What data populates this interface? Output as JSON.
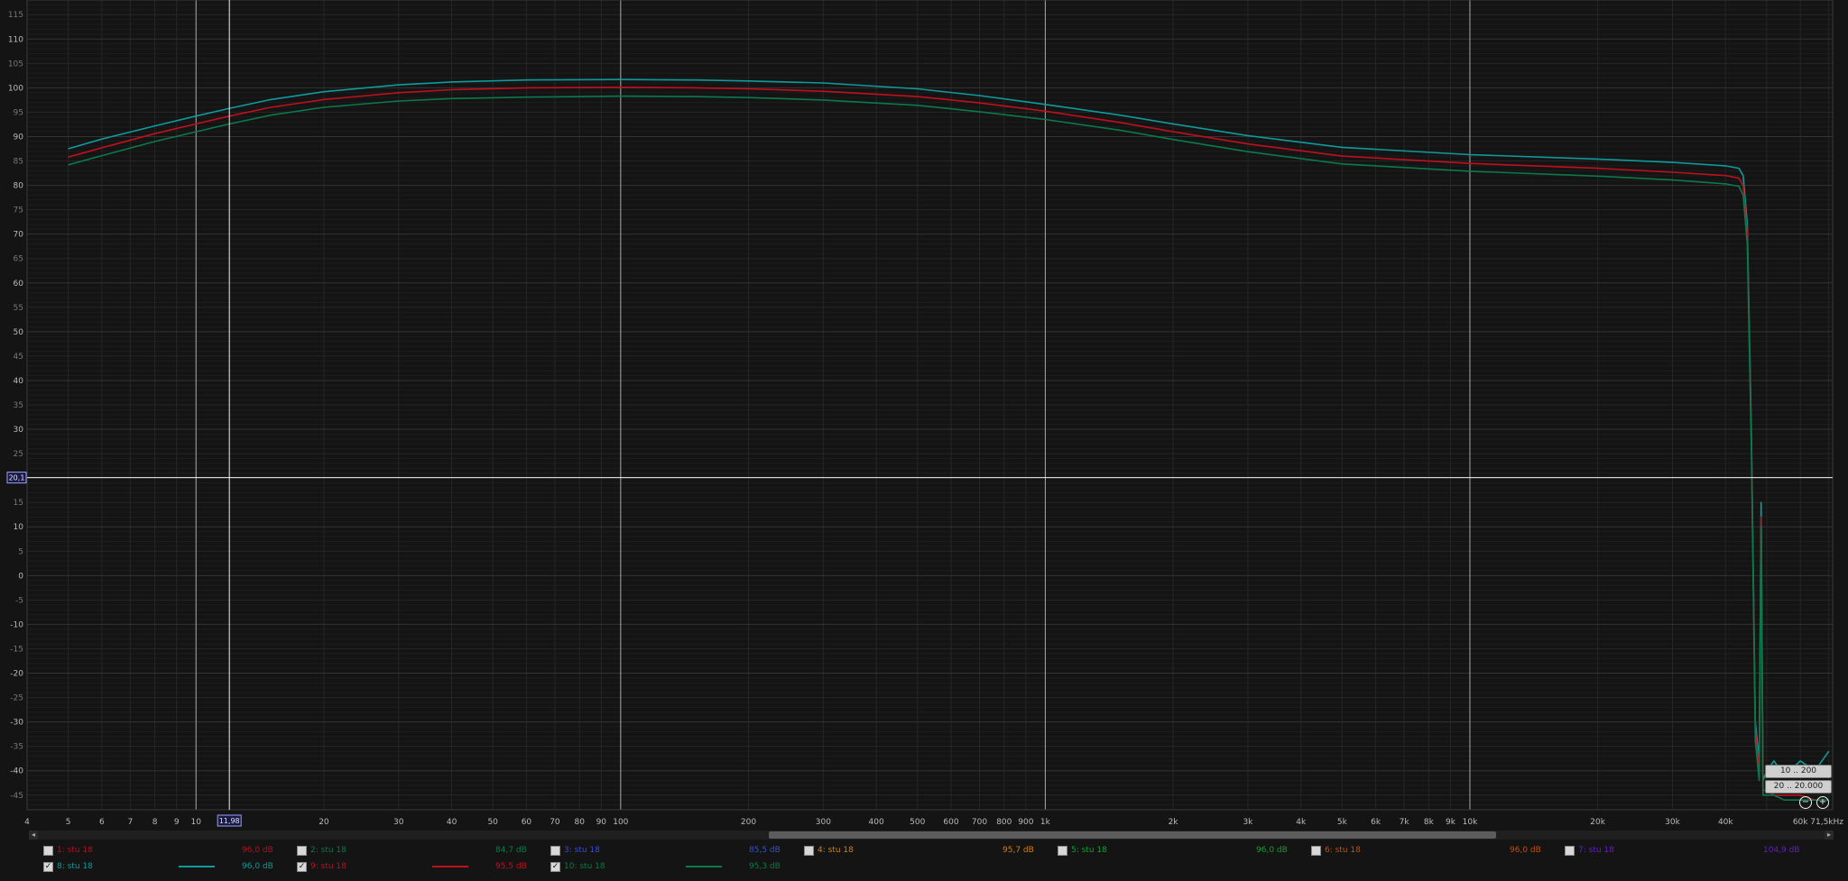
{
  "chart_data": {
    "type": "line",
    "x_scale": "log",
    "xlim": [
      4,
      71500
    ],
    "ylim": [
      -48,
      118
    ],
    "x_ticks": [
      {
        "v": 4,
        "l": "4"
      },
      {
        "v": 5,
        "l": "5"
      },
      {
        "v": 6,
        "l": "6"
      },
      {
        "v": 7,
        "l": "7"
      },
      {
        "v": 8,
        "l": "8"
      },
      {
        "v": 9,
        "l": "9"
      },
      {
        "v": 10,
        "l": "10"
      },
      {
        "v": 20,
        "l": "20"
      },
      {
        "v": 30,
        "l": "30"
      },
      {
        "v": 40,
        "l": "40"
      },
      {
        "v": 50,
        "l": "50"
      },
      {
        "v": 60,
        "l": "60"
      },
      {
        "v": 70,
        "l": "70"
      },
      {
        "v": 80,
        "l": "80"
      },
      {
        "v": 90,
        "l": "90"
      },
      {
        "v": 100,
        "l": "100"
      },
      {
        "v": 200,
        "l": "200"
      },
      {
        "v": 300,
        "l": "300"
      },
      {
        "v": 400,
        "l": "400"
      },
      {
        "v": 500,
        "l": "500"
      },
      {
        "v": 600,
        "l": "600"
      },
      {
        "v": 700,
        "l": "700"
      },
      {
        "v": 800,
        "l": "800"
      },
      {
        "v": 900,
        "l": "900"
      },
      {
        "v": 1000,
        "l": "1k"
      },
      {
        "v": 2000,
        "l": "2k"
      },
      {
        "v": 3000,
        "l": "3k"
      },
      {
        "v": 4000,
        "l": "4k"
      },
      {
        "v": 5000,
        "l": "5k"
      },
      {
        "v": 6000,
        "l": "6k"
      },
      {
        "v": 7000,
        "l": "7k"
      },
      {
        "v": 8000,
        "l": "8k"
      },
      {
        "v": 9000,
        "l": "9k"
      },
      {
        "v": 10000,
        "l": "10k"
      },
      {
        "v": 20000,
        "l": "20k"
      },
      {
        "v": 30000,
        "l": "30k"
      },
      {
        "v": 40000,
        "l": "40k"
      },
      {
        "v": 60000,
        "l": "60k"
      },
      {
        "v": 71500,
        "l": "71,5kHz"
      }
    ],
    "y_ticks": [
      115,
      110,
      105,
      100,
      95,
      90,
      85,
      80,
      75,
      70,
      65,
      60,
      55,
      50,
      45,
      40,
      35,
      30,
      25,
      20,
      15,
      10,
      5,
      0,
      -5,
      -10,
      -15,
      -20,
      -25,
      -30,
      -35,
      -40,
      -45
    ],
    "major_vlines": [
      10,
      100,
      1000,
      10000
    ],
    "cursor": {
      "x": 11.98,
      "x_label": "11,98",
      "y": 20.1,
      "y_label": "20,1"
    },
    "series": [
      {
        "color": "#0f9a9c",
        "x": [
          5,
          6,
          8,
          10,
          12,
          15,
          20,
          30,
          40,
          60,
          100,
          150,
          200,
          300,
          500,
          700,
          1000,
          1500,
          2000,
          3000,
          5000,
          10000,
          20000,
          30000,
          40000,
          43000,
          44000,
          45000,
          46000,
          47000,
          48000,
          48500,
          49000,
          50000,
          52000,
          55000,
          60000,
          65000,
          70000
        ],
        "y": [
          87.5,
          89.5,
          92.2,
          94.2,
          95.8,
          97.6,
          99.2,
          100.6,
          101.2,
          101.6,
          101.7,
          101.6,
          101.4,
          101.0,
          99.8,
          98.4,
          96.6,
          94.4,
          92.6,
          90.2,
          87.8,
          86.3,
          85.4,
          84.7,
          84.0,
          83.5,
          82.0,
          72.0,
          30.0,
          -30.0,
          -38.0,
          15.0,
          -42.0,
          -40.0,
          -38.0,
          -41.0,
          -38.0,
          -40.0,
          -36.0
        ]
      },
      {
        "color": "#c0101c",
        "x": [
          5,
          6,
          8,
          10,
          12,
          15,
          20,
          30,
          40,
          60,
          100,
          150,
          200,
          300,
          500,
          700,
          1000,
          1500,
          2000,
          3000,
          5000,
          10000,
          20000,
          30000,
          40000,
          43000,
          44000,
          45000,
          46000,
          47000,
          48000,
          48500,
          49000,
          50000,
          52000,
          55000,
          60000,
          65000,
          70000
        ],
        "y": [
          85.8,
          87.7,
          90.6,
          92.6,
          94.2,
          96.0,
          97.6,
          99.0,
          99.6,
          100.0,
          100.1,
          100.0,
          99.8,
          99.3,
          98.2,
          96.9,
          95.2,
          92.9,
          91.0,
          88.5,
          86.0,
          84.5,
          83.5,
          82.7,
          82.0,
          81.5,
          80.0,
          70.0,
          28.0,
          -32.0,
          -40.0,
          12.0,
          -44.0,
          -44.0,
          -45.0,
          -45.0,
          -45.0,
          -46.0,
          -46.0
        ]
      },
      {
        "color": "#0a7a4a",
        "x": [
          5,
          6,
          8,
          10,
          12,
          15,
          20,
          30,
          40,
          60,
          100,
          150,
          200,
          300,
          500,
          700,
          1000,
          1500,
          2000,
          3000,
          5000,
          10000,
          20000,
          30000,
          40000,
          43000,
          44000,
          45000,
          46000,
          47000,
          48000,
          48500,
          49000,
          50000,
          52000,
          55000,
          60000,
          65000,
          70000
        ],
        "y": [
          84.2,
          86.1,
          89.0,
          91.0,
          92.6,
          94.4,
          96.0,
          97.3,
          97.8,
          98.1,
          98.3,
          98.2,
          98.0,
          97.5,
          96.4,
          95.1,
          93.5,
          91.3,
          89.4,
          86.9,
          84.4,
          82.9,
          81.9,
          81.1,
          80.3,
          79.8,
          78.0,
          68.0,
          26.0,
          -34.0,
          -42.0,
          10.0,
          -45.0,
          -45.0,
          -45.0,
          -46.0,
          -46.0,
          -46.0,
          -46.0
        ]
      }
    ]
  },
  "scrollbar": {
    "left_arrow": "◂",
    "right_arrow": "▸"
  },
  "zoom": {
    "range1": "10 .. 200",
    "range2": "20 .. 20.000",
    "minus": "−",
    "plus": "+"
  },
  "legend": [
    {
      "name": "1: stu 18",
      "db": "96,0 dB",
      "checked": false,
      "color": "#c0101c",
      "name_color": "#b01020",
      "db_color": "#b01020",
      "show_line": false
    },
    {
      "name": "2: stu 18",
      "db": "84,7 dB",
      "checked": false,
      "color": "#0a7a4a",
      "name_color": "#0a7a4a",
      "db_color": "#0a7a4a",
      "show_line": false
    },
    {
      "name": "3: stu 18",
      "db": "85,5 dB",
      "checked": false,
      "color": "#3a4fd0",
      "name_color": "#3a4fd0",
      "db_color": "#3a4fd0",
      "show_line": false
    },
    {
      "name": "4: stu 18",
      "db": "95,7 dB",
      "checked": false,
      "color": "#d08010",
      "name_color": "#d08010",
      "db_color": "#d08010",
      "show_line": false
    },
    {
      "name": "5: stu 18",
      "db": "96,0 dB",
      "checked": false,
      "color": "#10a030",
      "name_color": "#10a030",
      "db_color": "#10a030",
      "show_line": false
    },
    {
      "name": "6: stu 18",
      "db": "96,0 dB",
      "checked": false,
      "color": "#c05010",
      "name_color": "#c05010",
      "db_color": "#c05010",
      "show_line": false
    },
    {
      "name": "7: stu 18",
      "db": "104,9 dB",
      "checked": false,
      "color": "#6020c0",
      "name_color": "#6020c0",
      "db_color": "#6020c0",
      "show_line": false
    },
    {
      "name": "8: stu 18",
      "db": "96,0 dB",
      "checked": true,
      "color": "#0f9a9c",
      "name_color": "#0f9a9c",
      "db_color": "#0f9a9c",
      "show_line": true
    },
    {
      "name": "9: stu 18",
      "db": "95,5 dB",
      "checked": true,
      "color": "#c0101c",
      "name_color": "#c0101c",
      "db_color": "#c0101c",
      "show_line": true
    },
    {
      "name": "10: stu 18",
      "db": "95,3 dB",
      "checked": true,
      "color": "#0a7a4a",
      "name_color": "#0a7a4a",
      "db_color": "#0a7a4a",
      "show_line": true
    }
  ]
}
